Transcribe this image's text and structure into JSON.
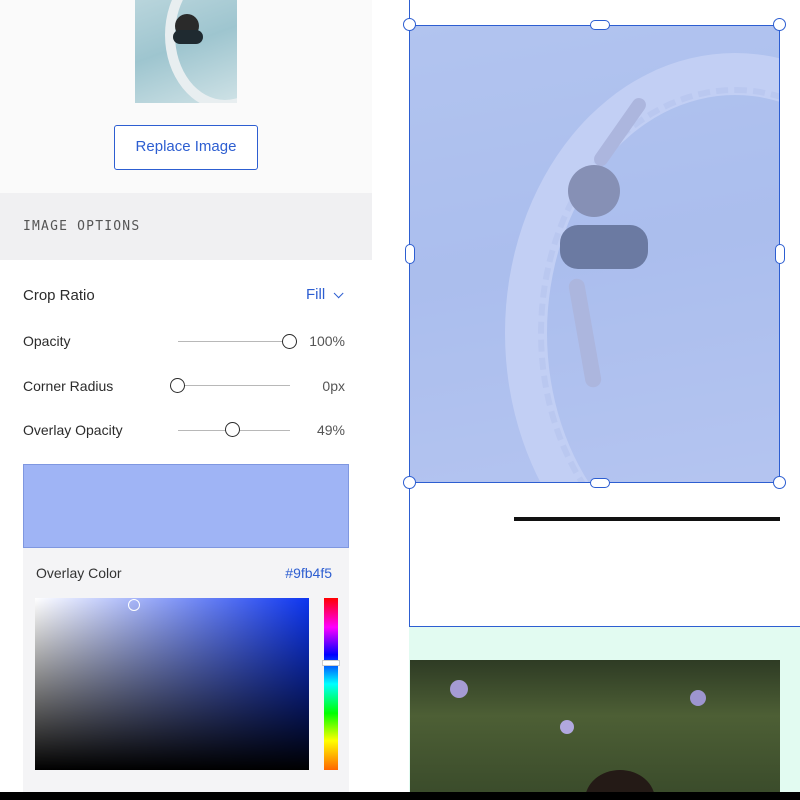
{
  "panel": {
    "replace_button": "Replace Image",
    "section_title": "IMAGE OPTIONS",
    "crop_ratio": {
      "label": "Crop Ratio",
      "value": "Fill"
    },
    "opacity": {
      "label": "Opacity",
      "value": "100%",
      "level": 1.0
    },
    "corner_radius": {
      "label": "Corner Radius",
      "value": "0px",
      "level": 0.0
    },
    "overlay_opacity": {
      "label": "Overlay Opacity",
      "value": "49%",
      "level": 0.49
    },
    "overlay_color": {
      "label": "Overlay Color",
      "hex": "#9fb4f5",
      "saturation": 0.36,
      "brightness": 0.96,
      "hue_level": 0.38
    }
  },
  "colors": {
    "accent": "#2d5ed1",
    "overlay": "#9fb4f5",
    "mint": "#e2fbf1"
  },
  "icons": {
    "crop_dropdown": "chevron-down-icon"
  }
}
